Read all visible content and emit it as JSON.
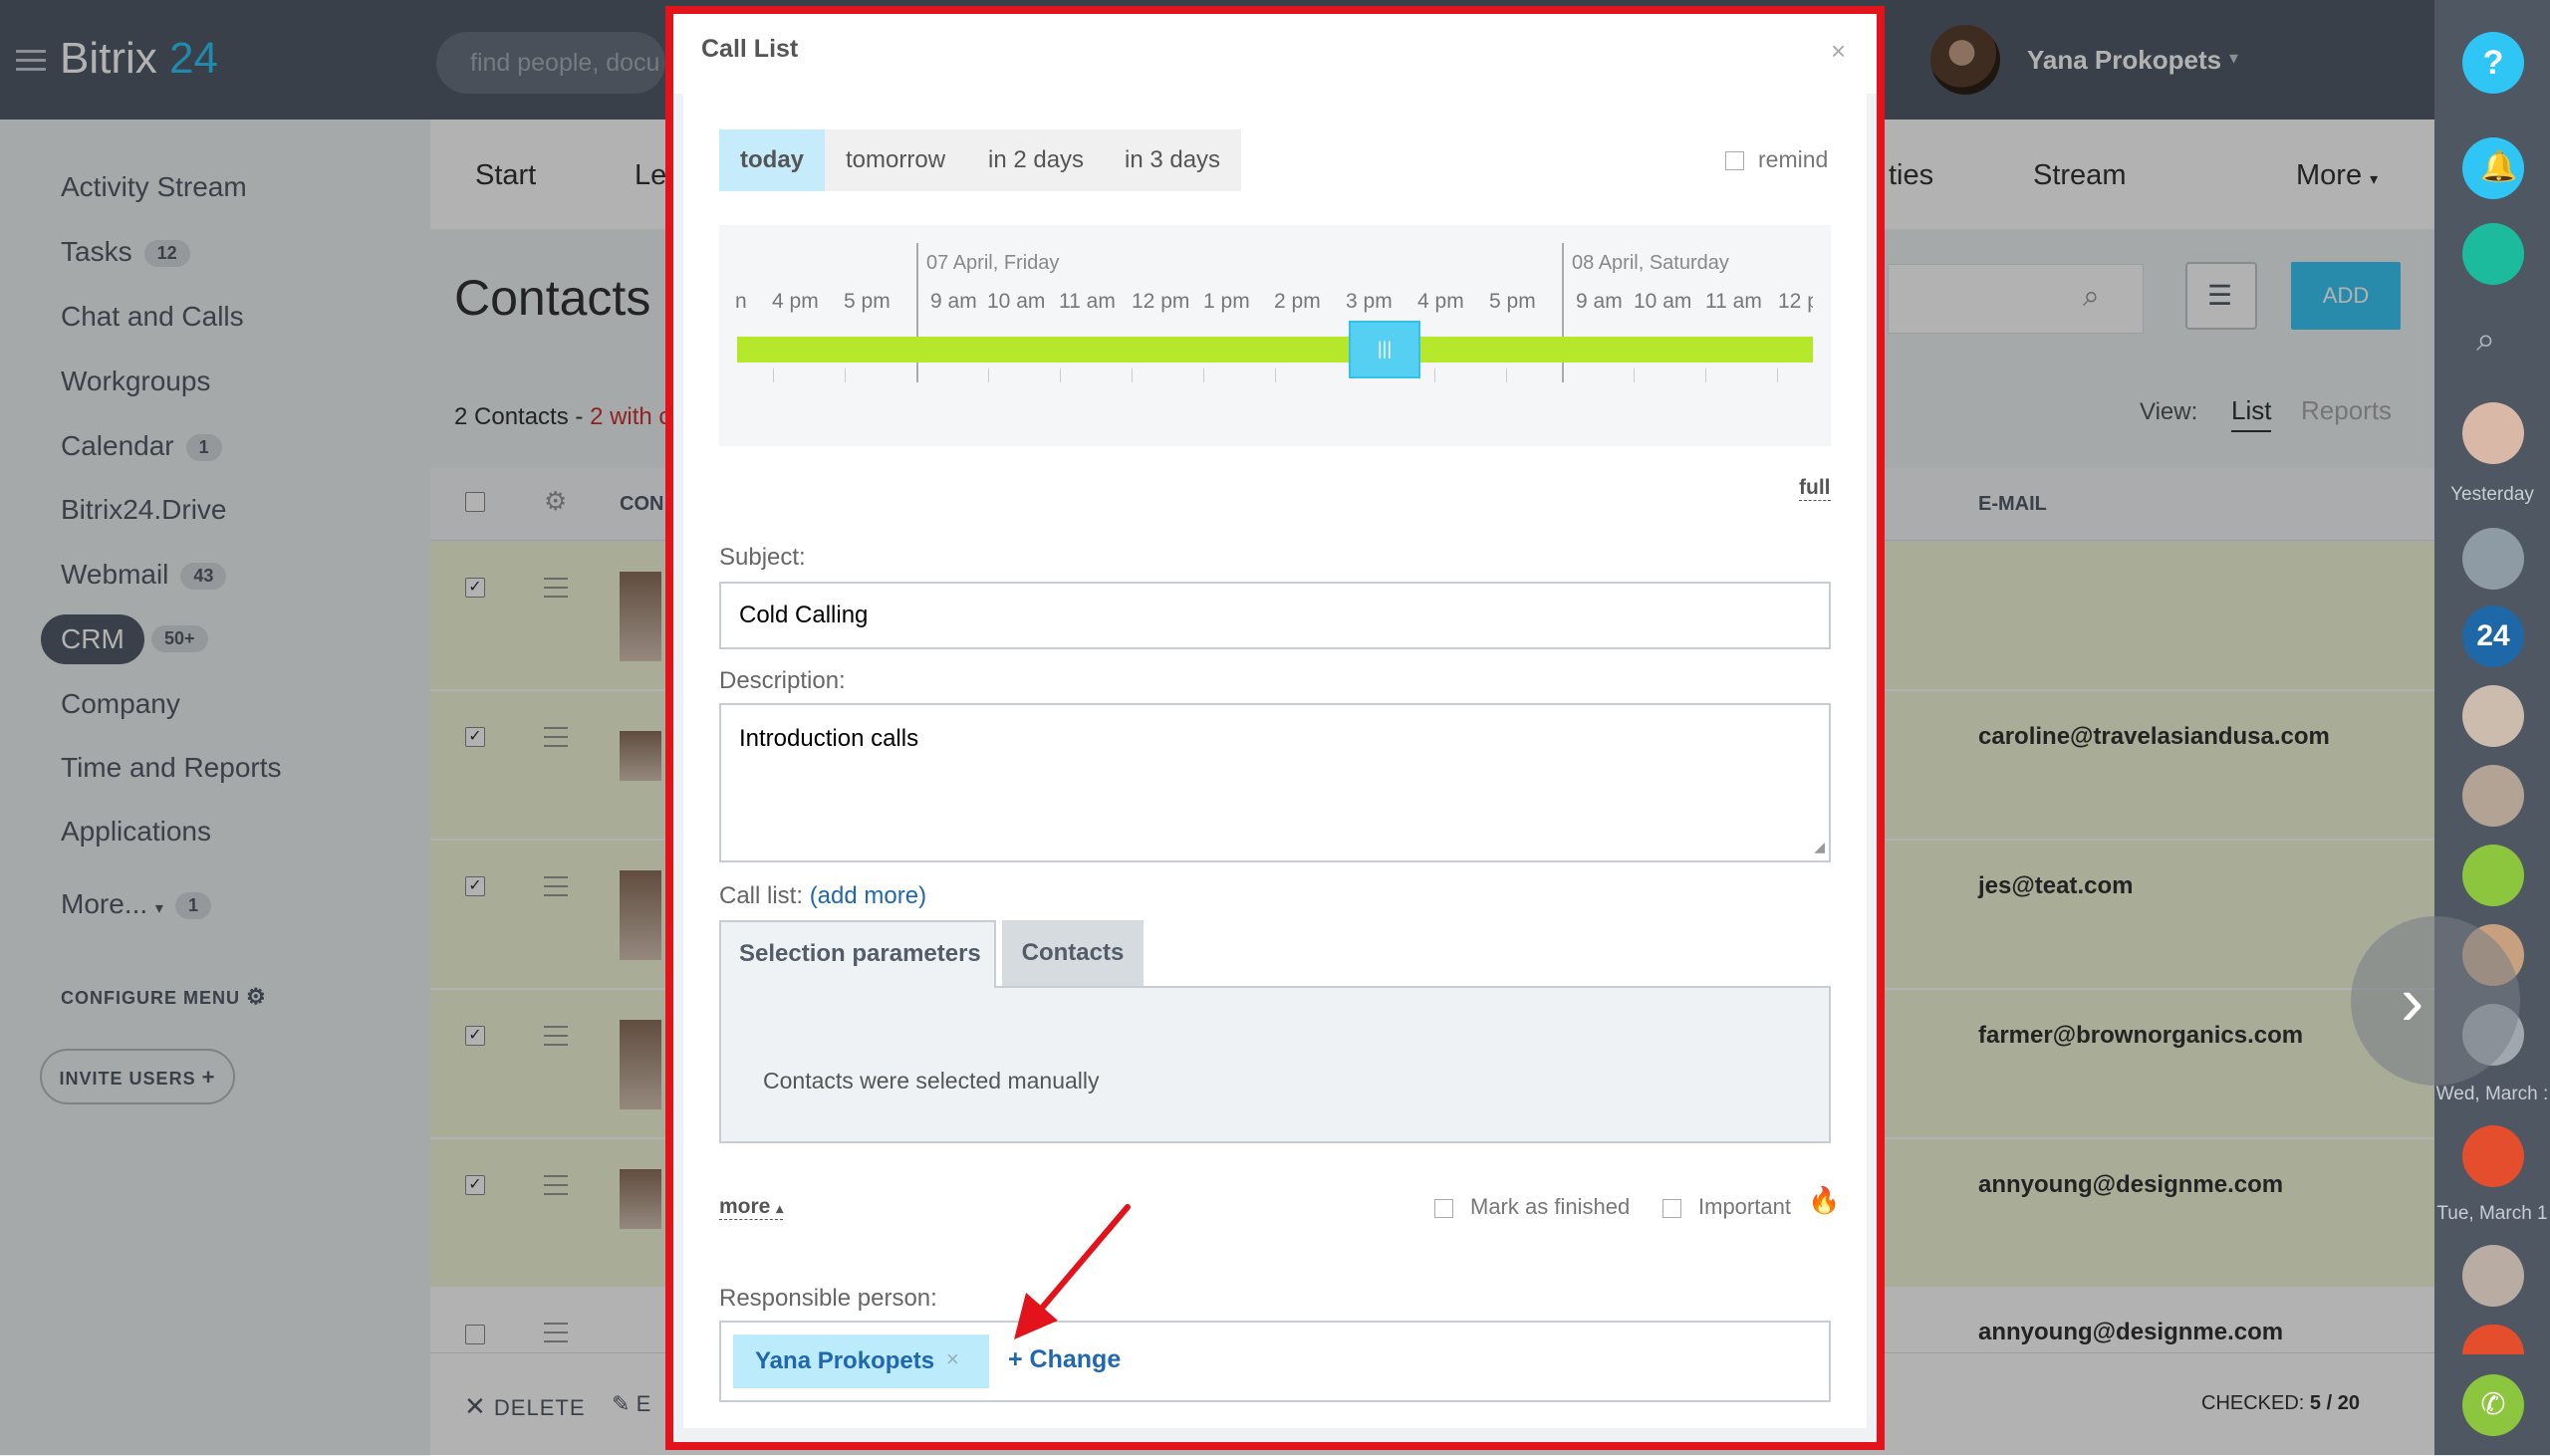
{
  "app": {
    "brand_main": "Bitrix",
    "brand_num": "24"
  },
  "search": {
    "placeholder": "find people, docu"
  },
  "user": {
    "name": "Yana Prokopets"
  },
  "sidebar": {
    "items": [
      {
        "label": "Activity Stream"
      },
      {
        "label": "Tasks",
        "badge": "12"
      },
      {
        "label": "Chat and Calls"
      },
      {
        "label": "Workgroups"
      },
      {
        "label": "Calendar",
        "badge": "1"
      },
      {
        "label": "Bitrix24.Drive"
      },
      {
        "label": "Webmail",
        "badge": "43"
      },
      {
        "label": "CRM",
        "badge": "50+"
      },
      {
        "label": "Company"
      },
      {
        "label": "Time and Reports"
      },
      {
        "label": "Applications"
      },
      {
        "label": "More...",
        "badge": "1"
      }
    ],
    "configure": "CONFIGURE MENU",
    "invite": "INVITE USERS"
  },
  "crm": {
    "tabs": [
      "Start",
      "Le",
      "ties",
      "Stream",
      "More"
    ],
    "title": "Contacts",
    "add": "ADD",
    "count_prefix": "2 Contacts - ",
    "count_red": "2 with c",
    "view_label": "View:",
    "view_list": "List",
    "view_reports": "Reports",
    "col_con": "CON",
    "col_email": "E-MAIL",
    "emails": [
      "caroline@travelasiandusa.com",
      "jes@teat.com",
      "farmer@brownorganics.com",
      "annyoung@designme.com",
      "annyoung@designme.com"
    ],
    "delete": "DELETE",
    "edit": "E",
    "checked_label": "CHECKED: ",
    "checked_value": "5 / 20"
  },
  "rail": {
    "labels": [
      "Yesterday",
      "Wed, March :",
      "Tue, March 1"
    ],
    "help": "?"
  },
  "modal": {
    "title": "Call List",
    "close": "×",
    "day_tabs": [
      "today",
      "tomorrow",
      "in 2 days",
      "in 3 days"
    ],
    "remind": "remind",
    "timeline": {
      "dates": [
        "07 April, Friday",
        "08 April, Saturday"
      ],
      "labels_day1": [
        "n",
        "4 pm",
        "5 pm"
      ],
      "labels_day2": [
        "9 am",
        "10 am",
        "11 am",
        "12 pm",
        "1 pm",
        "2 pm",
        "3 pm",
        "4 pm",
        "5 pm"
      ],
      "labels_day3": [
        "9 am",
        "10 am",
        "11 am",
        "12 p"
      ]
    },
    "full": "full",
    "subject_label": "Subject:",
    "subject_value": "Cold Calling",
    "description_label": "Description:",
    "description_value": "Introduction calls",
    "call_list_label": "Call list:",
    "add_more": "(add more)",
    "tab_params": "Selection parameters",
    "tab_contacts": "Contacts",
    "selection_text": "Contacts were selected manually",
    "more": "more",
    "mark_finished": "Mark as finished",
    "important": "Important",
    "responsible_label": "Responsible person:",
    "responsible_name": "Yana Prokopets",
    "change": "+ Change"
  },
  "colors": {
    "accent": "#3bc8f5",
    "highlight": "#e3131b",
    "timeline_bar": "#b5e82a",
    "link": "#2067b0"
  }
}
